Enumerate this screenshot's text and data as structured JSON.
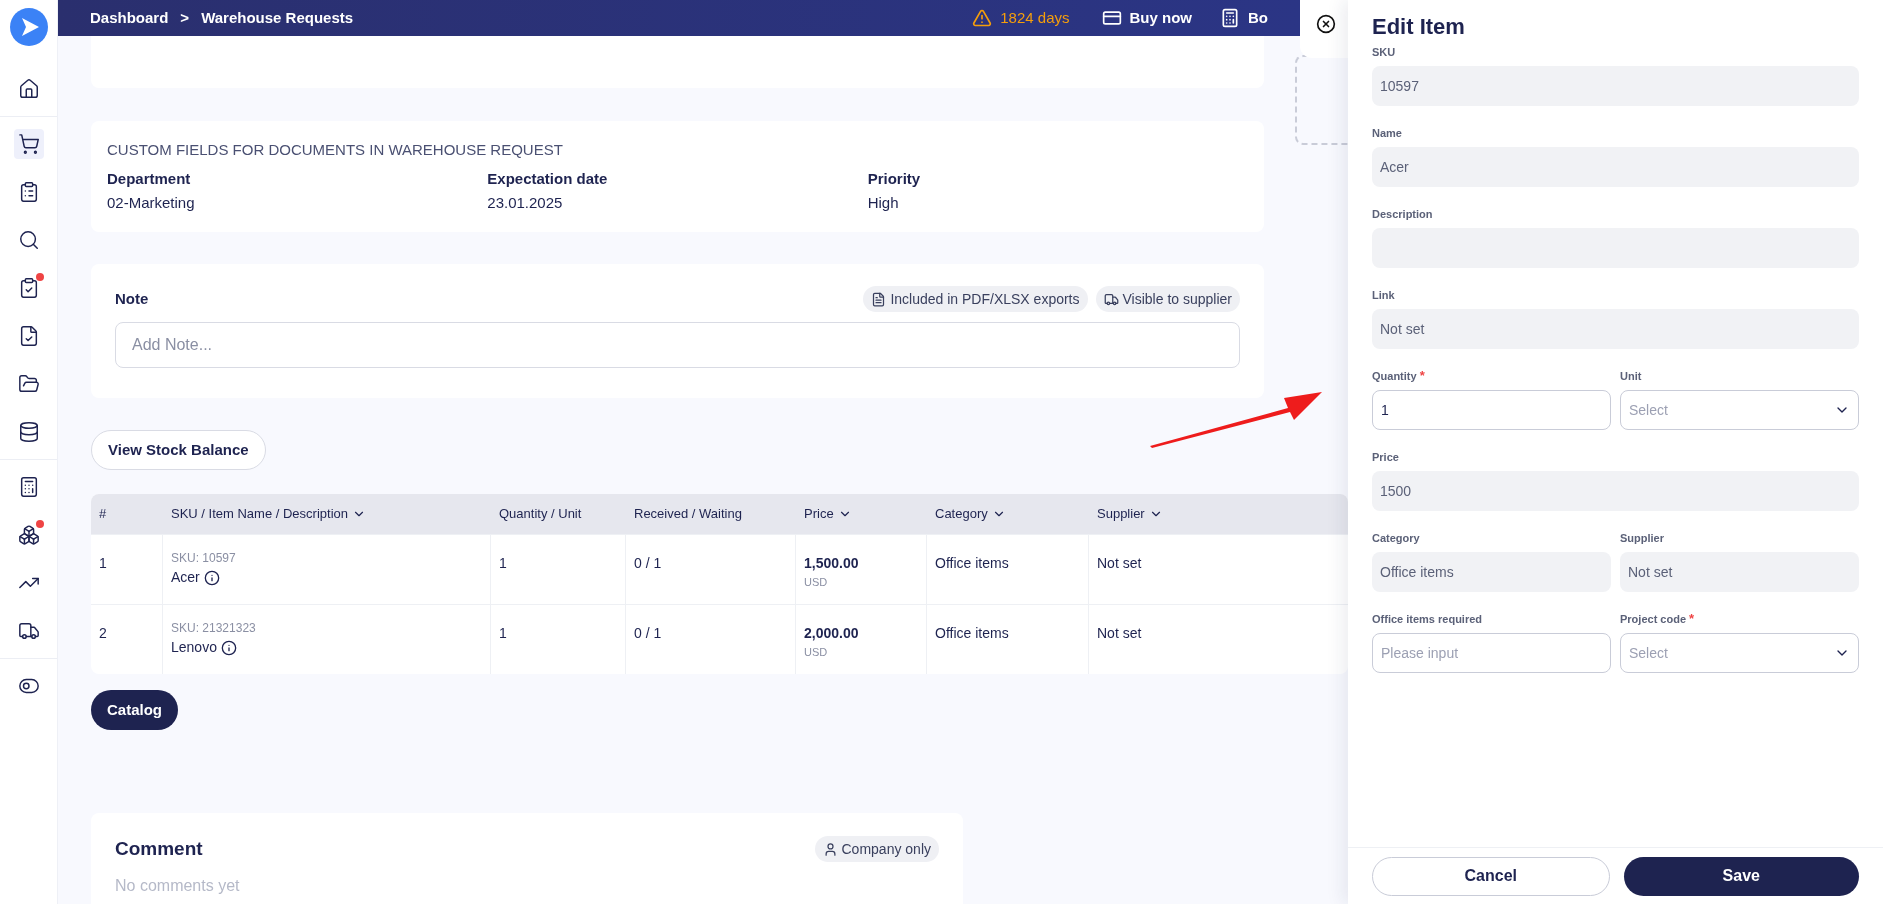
{
  "topbar": {
    "breadcrumbs": [
      "Dashboard",
      "Warehouse Requests"
    ],
    "separator": ">",
    "trial": "1824 days",
    "buy": "Buy now",
    "cut_action": "Bo"
  },
  "sidebar": {
    "groups": [
      [
        {
          "selected": false,
          "notification": false
        }
      ],
      [
        {
          "selected": true,
          "notification": false
        },
        {
          "selected": false,
          "notification": false
        },
        {
          "selected": false,
          "notification": false
        },
        {
          "selected": false,
          "notification": true
        },
        {
          "selected": false,
          "notification": false
        },
        {
          "selected": false,
          "notification": false
        },
        {
          "selected": false,
          "notification": false
        }
      ],
      [
        {
          "selected": false,
          "notification": false
        },
        {
          "selected": false,
          "notification": true
        },
        {
          "selected": false,
          "notification": false
        },
        {
          "selected": false,
          "notification": false
        }
      ],
      [
        {
          "selected": false,
          "notification": false
        }
      ]
    ]
  },
  "custom_fields": {
    "title": "CUSTOM FIELDS FOR DOCUMENTS IN WAREHOUSE REQUEST",
    "fields": [
      {
        "label": "Department",
        "value": "02-Marketing"
      },
      {
        "label": "Expectation date",
        "value": "23.01.2025"
      },
      {
        "label": "Priority",
        "value": "High"
      }
    ]
  },
  "note": {
    "title": "Note",
    "badges": [
      "Included in PDF/XLSX exports",
      "Visible to supplier"
    ],
    "placeholder": "Add Note..."
  },
  "stock_button": "View Stock Balance",
  "table": {
    "columns": [
      {
        "label": "#",
        "sortable": false
      },
      {
        "label": "SKU / Item Name / Description",
        "sortable": true
      },
      {
        "label": "Quantity / Unit",
        "sortable": false
      },
      {
        "label": "Received / Waiting",
        "sortable": false
      },
      {
        "label": "Price",
        "sortable": true
      },
      {
        "label": "Category",
        "sortable": true
      },
      {
        "label": "Supplier",
        "sortable": true
      }
    ],
    "rows": [
      {
        "number": "1",
        "sku": "SKU: 10597",
        "name": "Acer",
        "quantity": "1",
        "received": "0 / 1",
        "price": "1,500.00",
        "currency": "USD",
        "category": "Office items",
        "supplier": "Not set"
      },
      {
        "number": "2",
        "sku": "SKU: 21321323",
        "name": "Lenovo",
        "quantity": "1",
        "received": "0 / 1",
        "price": "2,000.00",
        "currency": "USD",
        "category": "Office items",
        "supplier": "Not set"
      }
    ]
  },
  "catalog_button": "Catalog",
  "comment": {
    "title": "Comment",
    "visibility": "Company only",
    "empty": "No comments yet"
  },
  "edit_panel": {
    "title": "Edit Item",
    "rows": [
      [
        {
          "label": "SKU",
          "kind": "readonly",
          "value": "10597",
          "required": false
        }
      ],
      [
        {
          "label": "Name",
          "kind": "readonly",
          "value": "Acer",
          "required": false
        }
      ],
      [
        {
          "label": "Description",
          "kind": "readonly",
          "required": false
        }
      ],
      [
        {
          "label": "Link",
          "kind": "readonly",
          "value": "Not set",
          "required": false
        }
      ],
      [
        {
          "label": "Quantity",
          "kind": "input",
          "value": "1",
          "required": true
        },
        {
          "label": "Unit",
          "kind": "select",
          "placeholder": "Select",
          "required": false
        }
      ],
      [
        {
          "label": "Price",
          "kind": "readonly",
          "value": "1500",
          "required": false
        }
      ],
      [
        {
          "label": "Category",
          "kind": "readonly",
          "value": "Office items",
          "required": false
        },
        {
          "label": "Supplier",
          "kind": "readonly",
          "value": "Not set",
          "required": false
        }
      ],
      [
        {
          "label": "Office items required",
          "kind": "input",
          "placeholder": "Please input",
          "required": false
        },
        {
          "label": "Project code",
          "kind": "select",
          "placeholder": "Select",
          "required": true
        }
      ]
    ],
    "required_mark": "*",
    "cancel": "Cancel",
    "save": "Save"
  }
}
